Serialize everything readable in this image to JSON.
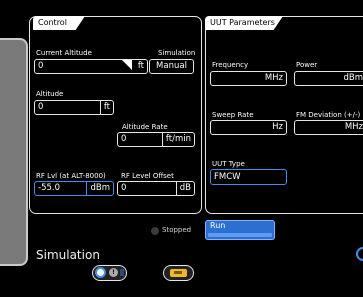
{
  "control": {
    "title": "Control",
    "current_altitude": {
      "label": "Current Altitude",
      "value": "0",
      "unit": "ft"
    },
    "simulation": {
      "label": "Simulation",
      "value": "Manual"
    },
    "altitude": {
      "label": "Altitude",
      "value": "0",
      "unit": "ft"
    },
    "altitude_rate": {
      "label": "Altitude Rate",
      "value": "0",
      "unit": "ft/min"
    },
    "rf_level": {
      "label": "RF Lvl (at ALT-8000)",
      "value": "-55.0",
      "unit": "dBm"
    },
    "rf_offset": {
      "label": "RF Level Offset",
      "value": "0",
      "unit": "dB"
    }
  },
  "uut": {
    "title": "UUT Parameters",
    "frequency": {
      "label": "Frequency",
      "value": "",
      "unit": "MHz"
    },
    "power": {
      "label": "Power",
      "value": "",
      "unit": "dBm"
    },
    "sweep_rate": {
      "label": "Sweep Rate",
      "value": "",
      "unit": "Hz"
    },
    "fm_deviation": {
      "label": "FM Deviation (+/-)",
      "value": "",
      "unit": "MHz"
    },
    "uut_type": {
      "label": "UUT Type",
      "value": "FMCW"
    }
  },
  "status": {
    "text": "Stopped"
  },
  "run": {
    "label": "Run"
  },
  "footer": {
    "title": "Simulation",
    "toggle_glyph": "!"
  },
  "colors": {
    "accent": "#3f8ee8",
    "run_button": "#2c6fd1",
    "card_icon": "#f3b72a"
  },
  "icons": {
    "altitude_marker": "flag-marker-icon",
    "mode_toggle": "mode-switch-icon",
    "card_toggle": "card-icon"
  }
}
